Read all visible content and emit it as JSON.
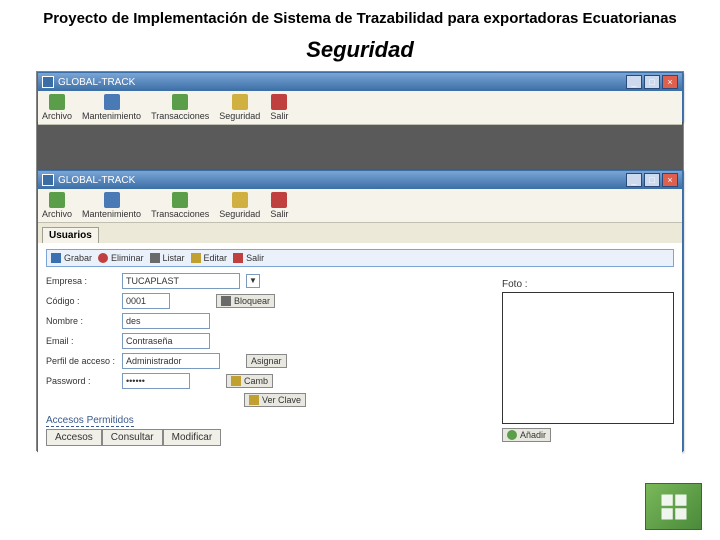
{
  "slide": {
    "title": "Proyecto de Implementación de Sistema de Trazabilidad para exportadoras Ecuatorianas",
    "section": "Seguridad"
  },
  "window1": {
    "title": "GLOBAL-TRACK",
    "toolbar": [
      "Archivo",
      "Mantenimiento",
      "Transacciones",
      "Seguridad",
      "Salir"
    ]
  },
  "window2": {
    "title": "GLOBAL-TRACK",
    "tab": "Usuarios",
    "subtoolbar": {
      "save": "Grabar",
      "del": "Eliminar",
      "list": "Listar",
      "edit": "Editar",
      "exit": "Salir"
    },
    "form": {
      "empresa_label": "Empresa :",
      "empresa_value": "TUCAPLAST",
      "codigo_label": "Código :",
      "codigo_value": "0001",
      "nombre_label": "Nombre :",
      "nombre_value": "des",
      "email_label": "Email :",
      "email_value": "Contraseña",
      "perfil_label": "Perfil de acceso :",
      "perfil_value": "Administrador",
      "asignar_btn": "Asignar",
      "password_label": "Password :",
      "password_value": "••••••",
      "camb_btn": "Camb",
      "verclave_btn": "Ver Clave",
      "bloquear_btn": "Bloquear",
      "foto_label": "Foto :",
      "add_btn": "Añadir"
    },
    "accesos": {
      "title": "Accesos Permitidos",
      "cols": [
        "Accesos",
        "Consultar",
        "Modificar"
      ]
    }
  }
}
